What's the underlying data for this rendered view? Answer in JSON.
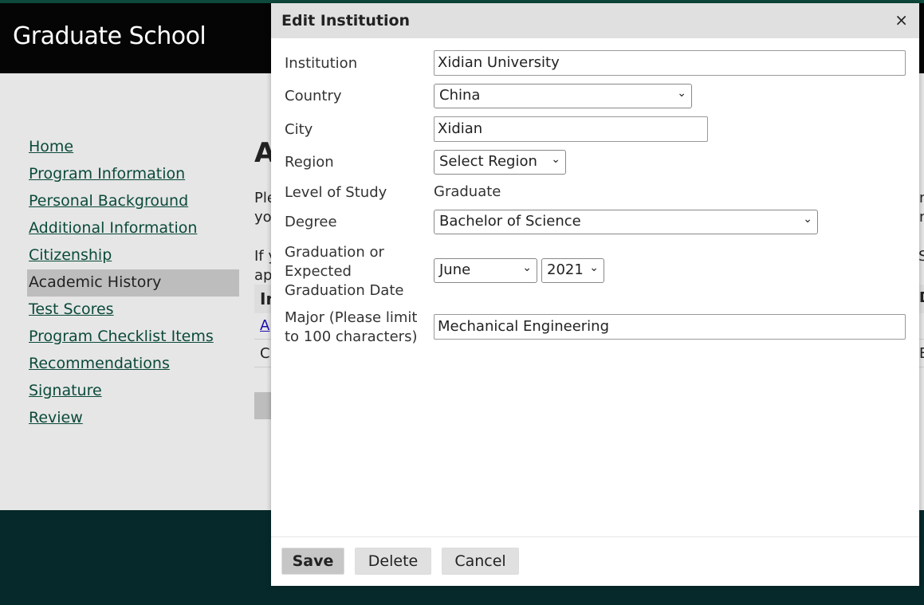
{
  "header": {
    "title": "Graduate School"
  },
  "sidebar": {
    "items": [
      {
        "label": "Home"
      },
      {
        "label": "Program Information"
      },
      {
        "label": "Personal Background"
      },
      {
        "label": "Additional Information"
      },
      {
        "label": "Citizenship"
      },
      {
        "label": "Academic History",
        "active": true
      },
      {
        "label": "Test Scores"
      },
      {
        "label": "Program Checklist Items"
      },
      {
        "label": "Recommendations"
      },
      {
        "label": "Signature"
      },
      {
        "label": "Review"
      }
    ]
  },
  "background": {
    "heading": "A",
    "para1a": "Ple",
    "para1b": "yo",
    "para2a": "If y",
    "para2b": "ap",
    "table_header": "In",
    "link": "A",
    "cell": "C",
    "right1": "n",
    "right2": "n:",
    "right3": "S",
    "right4": "D",
    "right5": "E"
  },
  "modal": {
    "title": "Edit Institution",
    "close": "×",
    "institution": {
      "label": "Institution",
      "value": "Xidian University"
    },
    "country": {
      "label": "Country",
      "value": "China"
    },
    "city": {
      "label": "City",
      "value": "Xidian"
    },
    "region": {
      "label": "Region",
      "value": "Select Region"
    },
    "level": {
      "label": "Level of Study",
      "value": "Graduate"
    },
    "degree": {
      "label": "Degree",
      "value": "Bachelor of Science"
    },
    "graduation": {
      "label": "Graduation or Expected Graduation Date",
      "month": "June",
      "year": "2021"
    },
    "major": {
      "label": "Major (Please limit to 100 characters)",
      "value": "Mechanical Engineering"
    },
    "buttons": {
      "save": "Save",
      "delete": "Delete",
      "cancel": "Cancel"
    }
  }
}
